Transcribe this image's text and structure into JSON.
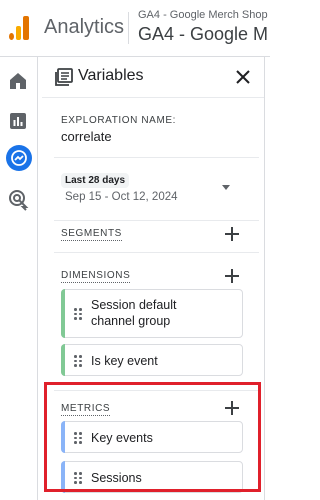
{
  "topbar": {
    "app_name": "Analytics",
    "account": "GA4 - Google Merch Shop",
    "property": "GA4 - Google M"
  },
  "panel": {
    "title": "Variables",
    "exploration_label": "EXPLORATION NAME:",
    "exploration_name": "correlate",
    "date_chip": "Last 28 days",
    "date_range": "Sep 15 - Oct 12, 2024",
    "segments_label": "SEGMENTS",
    "dimensions_label": "DIMENSIONS",
    "dimensions": [
      {
        "label_line1": "Session default",
        "label_line2": "channel group"
      },
      {
        "label": "Is key event"
      }
    ],
    "metrics_label": "METRICS",
    "metrics": [
      {
        "label": "Key events"
      },
      {
        "label": "Sessions"
      }
    ]
  },
  "icons": {
    "nav": [
      "home-icon",
      "reports-icon",
      "explore-icon",
      "advertising-icon"
    ],
    "panel_title": "variables-icon",
    "close": "close-icon",
    "add": "plus-icon",
    "drag": "drag-handle-icon"
  },
  "colors": {
    "dimension_accent": "#81c995",
    "metric_accent": "#8ab4f8",
    "explore_active": "#1a73e8",
    "highlight_box": "#e0202b"
  }
}
